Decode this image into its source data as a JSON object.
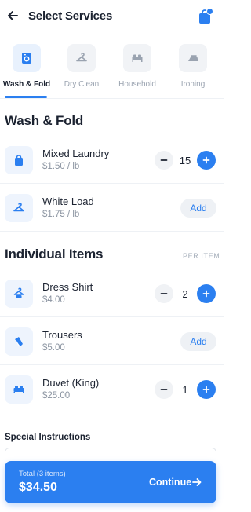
{
  "header": {
    "title": "Select Services",
    "back_icon": "arrow-left-icon",
    "bag_icon": "shopping-bag-icon"
  },
  "colors": {
    "accent": "#2b7ff0",
    "text": "#1b2230",
    "muted": "#8a93a0"
  },
  "tabs": [
    {
      "label": "Wash & Fold",
      "icon": "washing-machine-icon",
      "active": true
    },
    {
      "label": "Dry Clean",
      "icon": "hanger-icon",
      "active": false
    },
    {
      "label": "Household",
      "icon": "bed-icon",
      "active": false
    },
    {
      "label": "Ironing",
      "icon": "iron-icon",
      "active": false
    }
  ],
  "wash_fold": {
    "title": "Wash & Fold",
    "items": [
      {
        "name": "Mixed Laundry",
        "price": "$1.50 / lb",
        "qty": "15",
        "icon": "bag-icon"
      },
      {
        "name": "White Load",
        "price": "$1.75 / lb",
        "add_label": "Add",
        "icon": "hanger-icon"
      }
    ]
  },
  "individual": {
    "title": "Individual Items",
    "per_item": "PER ITEM",
    "items": [
      {
        "name": "Dress Shirt",
        "price": "$4.00",
        "qty": "2",
        "icon": "shirt-icon"
      },
      {
        "name": "Trousers",
        "price": "$5.00",
        "add_label": "Add",
        "icon": "trousers-icon"
      },
      {
        "name": "Duvet (King)",
        "price": "$25.00",
        "qty": "1",
        "icon": "bed-icon"
      }
    ]
  },
  "special_instructions": {
    "label": "Special Instructions"
  },
  "footer": {
    "total_label": "Total (3 items)",
    "total_value": "$34.50",
    "continue_label": "Continue",
    "arrow_icon": "arrow-right-icon"
  }
}
